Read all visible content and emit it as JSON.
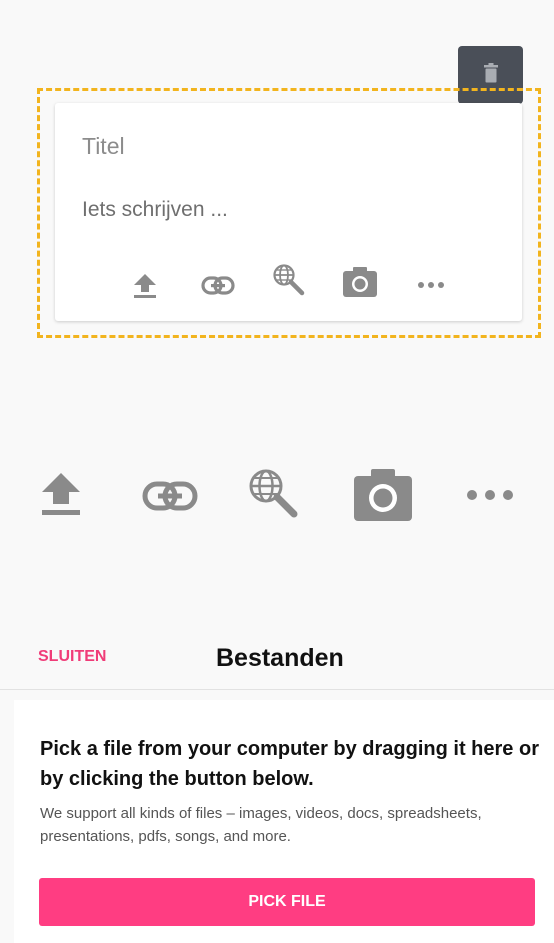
{
  "card": {
    "title_placeholder": "Titel",
    "body_placeholder": "Iets schrijven ..."
  },
  "icons": [
    "upload-icon",
    "link-icon",
    "globe-search-icon",
    "camera-icon",
    "more-icon"
  ],
  "panel": {
    "close_label": "SLUITEN",
    "title": "Bestanden",
    "heading": "Pick a file from your computer by dragging it here or by clicking the button below.",
    "description": "We support all kinds of files – images, videos, docs, spreadsheets, presentations, pdfs, songs, and more.",
    "button_label": "PICK FILE"
  },
  "colors": {
    "accent": "#ff3d82",
    "dashed_border": "#f2b41e",
    "delete_bg": "#4a4f58",
    "icon_gray": "#8a8a8a"
  }
}
